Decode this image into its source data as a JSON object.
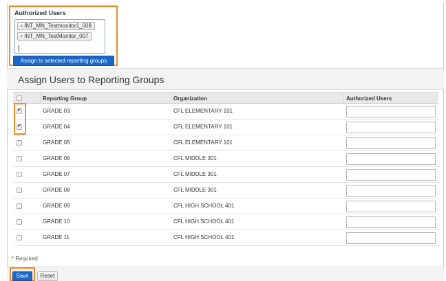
{
  "authorized_users": {
    "label": "Authorized Users",
    "selected": [
      {
        "remove_icon": "×",
        "name": "INT_MN_Testmonitor1_008"
      },
      {
        "remove_icon": "×",
        "name": "INT_MN_TestMonitor_007"
      }
    ],
    "assign_button": "Assign to selected reporting groups"
  },
  "section": {
    "title": "Assign Users to Reporting Groups"
  },
  "table": {
    "columns": [
      "Reporting Group",
      "Organization",
      "Authorized Users"
    ],
    "rows": [
      {
        "checked": true,
        "group": "GRADE 03",
        "org": "CFL ELEMENTARY 101",
        "auth": ""
      },
      {
        "checked": true,
        "group": "GRADE 04",
        "org": "CFL ELEMENTARY 101",
        "auth": ""
      },
      {
        "checked": false,
        "group": "GRADE 05",
        "org": "CFL ELEMENTARY 101",
        "auth": ""
      },
      {
        "checked": false,
        "group": "GRADE 06",
        "org": "CFL MIDDLE 301",
        "auth": ""
      },
      {
        "checked": false,
        "group": "GRADE 07",
        "org": "CFL MIDDLE 301",
        "auth": ""
      },
      {
        "checked": false,
        "group": "GRADE 08",
        "org": "CFL MIDDLE 301",
        "auth": ""
      },
      {
        "checked": false,
        "group": "GRADE 09",
        "org": "CFL HIGH SCHOOL 401",
        "auth": ""
      },
      {
        "checked": false,
        "group": "GRADE 10",
        "org": "CFL HIGH SCHOOL 401",
        "auth": ""
      },
      {
        "checked": false,
        "group": "GRADE 11",
        "org": "CFL HIGH SCHOOL 401",
        "auth": ""
      }
    ]
  },
  "required_note": "* Required",
  "footer": {
    "save_label": "Save",
    "reset_label": "Reset"
  },
  "colors": {
    "highlight": "#f08a24",
    "primary_button": "#1a67c9"
  }
}
